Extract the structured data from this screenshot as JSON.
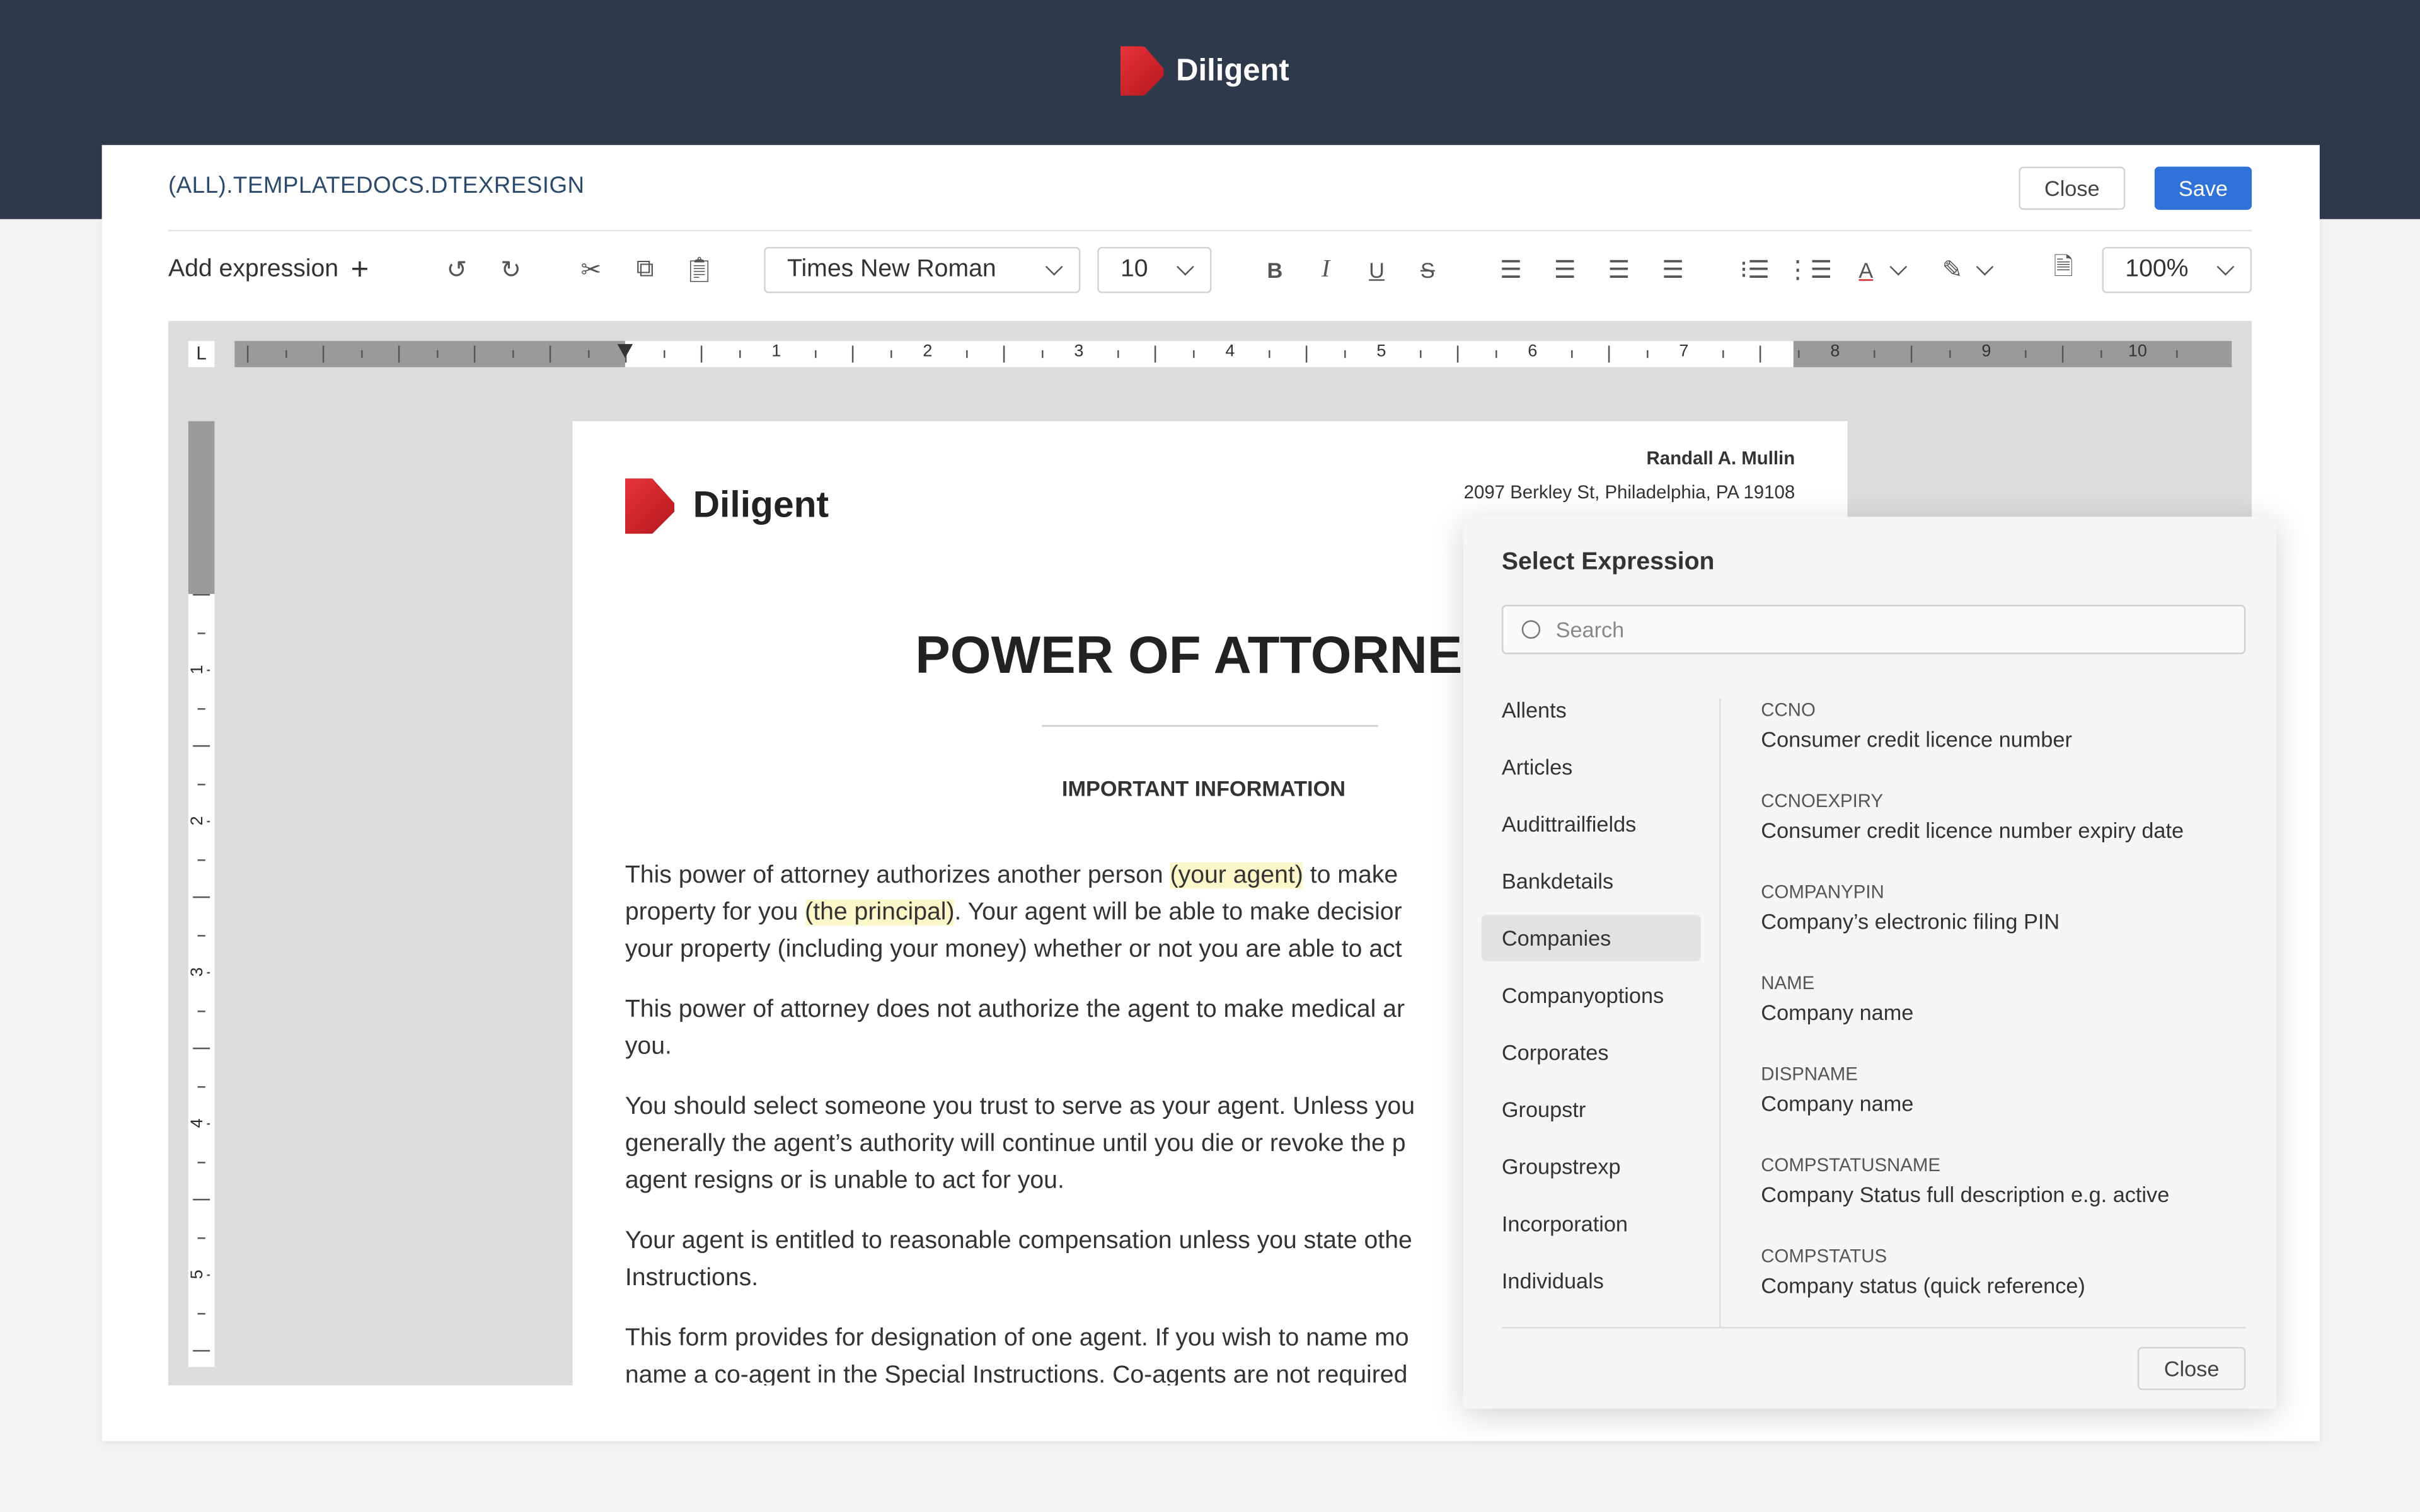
{
  "app": {
    "brand": "Diligent"
  },
  "header": {
    "title": "(ALL).TEMPLATEDOCS.DTEXRESIGN",
    "close_label": "Close",
    "save_label": "Save"
  },
  "toolbar": {
    "add_expression": "Add expression",
    "font": "Times New Roman",
    "size": "10",
    "zoom": "100%"
  },
  "ruler": {
    "labels": [
      "1",
      "2",
      "3",
      "4",
      "5",
      "6",
      "7",
      "8",
      "9",
      "10"
    ],
    "vertical_labels": [
      "1",
      "2",
      "3",
      "4",
      "5"
    ],
    "corner": "L"
  },
  "document": {
    "brand": "Diligent",
    "sender_name": "Randall A. Mullin",
    "sender_address": "2097 Berkley St, Philadelphia, PA 19108",
    "title": "POWER OF ATTORNE",
    "subtitle": "IMPORTANT INFORMATION",
    "p1": [
      "This power of attorney authorizes another person ",
      "(your agent)",
      " to make",
      "property for you ",
      "(the principal)",
      ". Your agent will be able to make decisior",
      "your property (including your money) whether or not you are able to act"
    ],
    "p2": [
      "This power of attorney does not authorize the agent to make medical ar",
      "you."
    ],
    "p3": [
      "You should select someone you trust to serve as your agent. Unless you",
      "generally the agent’s authority will continue until you die or revoke the p",
      "agent resigns or is unable to act for you."
    ],
    "p4": [
      "Your agent is entitled to reasonable compensation unless you state othe",
      "Instructions."
    ],
    "p5": [
      "This form provides for designation of one agent. If you wish to name mo",
      "name a co-agent in the Special Instructions. Co-agents are not required"
    ]
  },
  "popup": {
    "title": "Select Expression",
    "search_placeholder": "Search",
    "categories": [
      "Allents",
      "Articles",
      "Audittrailfields",
      "Bankdetails",
      "Companies",
      "Companyoptions",
      "Corporates",
      "Groupstr",
      "Groupstrexp",
      "Incorporation",
      "Individuals"
    ],
    "active_category": "Companies",
    "expressions": [
      {
        "key": "CCNO",
        "desc": "Consumer credit licence number"
      },
      {
        "key": "CCNOEXPIRY",
        "desc": "Consumer credit licence number expiry date"
      },
      {
        "key": "COMPANYPIN",
        "desc": "Company’s electronic filing PIN"
      },
      {
        "key": "NAME",
        "desc": "Company name"
      },
      {
        "key": "DISPNAME",
        "desc": "Company name"
      },
      {
        "key": "COMPSTATUSNAME",
        "desc": "Company Status full description e.g. active"
      },
      {
        "key": "COMPSTATUS",
        "desc": "Company status (quick reference)"
      }
    ],
    "close_label": "Close"
  },
  "colors": {
    "topbar": "#2e3a4c",
    "primary": "#2f73d9",
    "title": "#2c4a6b",
    "brand_red": "#d8262d",
    "highlight": "#fbf7c8"
  }
}
